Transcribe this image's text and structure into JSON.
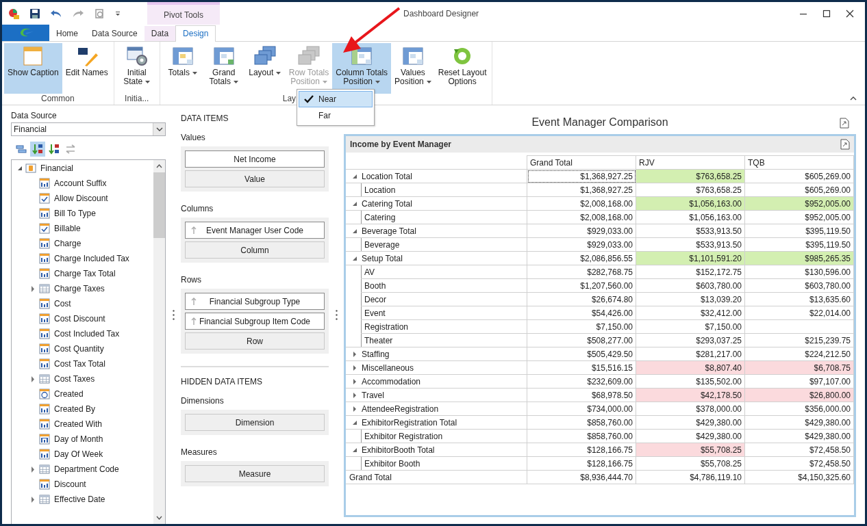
{
  "window": {
    "title": "Dashboard Designer"
  },
  "contextual_group": {
    "label": "Pivot Tools"
  },
  "tabs": [
    {
      "label": "Home",
      "selected": false,
      "contextual": false
    },
    {
      "label": "Data Source",
      "selected": false,
      "contextual": false
    },
    {
      "label": "Data",
      "selected": false,
      "contextual": true
    },
    {
      "label": "Design",
      "selected": true,
      "contextual": true
    }
  ],
  "ribbon_groups": [
    {
      "label": "Common",
      "buttons": [
        {
          "label": "Show Caption",
          "selected": true,
          "disabled": false,
          "dropdown": false
        },
        {
          "label": "Edit Names",
          "selected": false,
          "disabled": false,
          "dropdown": false
        }
      ]
    },
    {
      "label": "Initia...",
      "buttons": [
        {
          "label": "Initial\nState",
          "selected": false,
          "disabled": false,
          "dropdown": true
        }
      ]
    },
    {
      "label": "Lay",
      "buttons": [
        {
          "label": "Totals",
          "selected": false,
          "disabled": false,
          "dropdown": true
        },
        {
          "label": "Grand\nTotals",
          "selected": false,
          "disabled": false,
          "dropdown": true
        },
        {
          "label": "Layout",
          "selected": false,
          "disabled": false,
          "dropdown": true
        },
        {
          "label": "Row Totals\nPosition",
          "selected": false,
          "disabled": true,
          "dropdown": true
        },
        {
          "label": "Column Totals\nPosition",
          "selected": true,
          "disabled": false,
          "dropdown": true
        },
        {
          "label": "Values\nPosition",
          "selected": false,
          "disabled": false,
          "dropdown": true
        },
        {
          "label": "Reset Layout\nOptions",
          "selected": false,
          "disabled": false,
          "dropdown": false
        }
      ]
    }
  ],
  "dropdown_menu": [
    {
      "label": "Near",
      "checked": true,
      "selected": true
    },
    {
      "label": "Far",
      "checked": false,
      "selected": false
    }
  ],
  "data_source": {
    "label": "Data Source",
    "value": "Financial"
  },
  "field_toolbar": [
    {
      "selected": false
    },
    {
      "selected": true
    },
    {
      "selected": false
    },
    {
      "selected": false
    }
  ],
  "field_tree": {
    "label": "Financial",
    "expanded": true,
    "children": [
      {
        "label": "Account Suffix",
        "kind": "text"
      },
      {
        "label": "Allow Discount",
        "kind": "bool"
      },
      {
        "label": "Bill To Type",
        "kind": "text"
      },
      {
        "label": "Billable",
        "kind": "bool"
      },
      {
        "label": "Charge",
        "kind": "number"
      },
      {
        "label": "Charge Included Tax",
        "kind": "number"
      },
      {
        "label": "Charge Tax Total",
        "kind": "number"
      },
      {
        "label": "Charge Taxes",
        "kind": "table",
        "expanded": false
      },
      {
        "label": "Cost",
        "kind": "number"
      },
      {
        "label": "Cost Discount",
        "kind": "number"
      },
      {
        "label": "Cost Included Tax",
        "kind": "number"
      },
      {
        "label": "Cost Quantity",
        "kind": "number"
      },
      {
        "label": "Cost Tax Total",
        "kind": "number"
      },
      {
        "label": "Cost Taxes",
        "kind": "table",
        "expanded": false
      },
      {
        "label": "Created",
        "kind": "date"
      },
      {
        "label": "Created By",
        "kind": "text"
      },
      {
        "label": "Created With",
        "kind": "text"
      },
      {
        "label": "Day of Month",
        "kind": "integer"
      },
      {
        "label": "Day Of Week",
        "kind": "text"
      },
      {
        "label": "Department Code",
        "kind": "table",
        "expanded": false
      },
      {
        "label": "Discount",
        "kind": "number"
      },
      {
        "label": "Effective Date",
        "kind": "table",
        "expanded": false
      }
    ]
  },
  "data_items": {
    "heading": "DATA ITEMS",
    "sections": [
      {
        "title": "Values",
        "items": [
          {
            "label": "Net Income",
            "kind": "field",
            "sorted": false
          },
          {
            "label": "Value",
            "kind": "empty",
            "sorted": false
          }
        ]
      },
      {
        "title": "Columns",
        "items": [
          {
            "label": "Event Manager User Code",
            "kind": "field",
            "sorted": true
          },
          {
            "label": "Column",
            "kind": "empty",
            "sorted": false
          }
        ]
      },
      {
        "title": "Rows",
        "items": [
          {
            "label": "Financial Subgroup Type",
            "kind": "field",
            "sorted": true
          },
          {
            "label": "Financial Subgroup Item Code",
            "kind": "field",
            "sorted": true
          },
          {
            "label": "Row",
            "kind": "empty",
            "sorted": false
          }
        ]
      }
    ]
  },
  "hidden_data_items": {
    "heading": "HIDDEN DATA ITEMS",
    "sections": [
      {
        "title": "Dimensions",
        "items": [
          {
            "label": "Dimension",
            "kind": "empty",
            "sorted": false
          }
        ]
      },
      {
        "title": "Measures",
        "items": [
          {
            "label": "Measure",
            "kind": "empty",
            "sorted": false
          }
        ]
      }
    ]
  },
  "dashboard": {
    "title": "Event Manager Comparison"
  },
  "pivot": {
    "caption": "Income by Event Manager",
    "columns": [
      "Grand Total",
      "RJV",
      "TQB"
    ],
    "rows": [
      {
        "label": "Location Total",
        "kind": "group",
        "expanded": true,
        "cells": [
          {
            "text": "$1,368,927.25"
          },
          {
            "text": "$763,658.25",
            "color": "#d3efb1"
          },
          {
            "text": "$605,269.00"
          }
        ],
        "children": [
          {
            "label": "Location",
            "cells": [
              {
                "text": "$1,368,927.25"
              },
              {
                "text": "$763,658.25"
              },
              {
                "text": "$605,269.00"
              }
            ]
          }
        ]
      },
      {
        "label": "Catering Total",
        "kind": "group",
        "expanded": true,
        "cells": [
          {
            "text": "$2,008,168.00"
          },
          {
            "text": "$1,056,163.00",
            "color": "#d3efb1"
          },
          {
            "text": "$952,005.00",
            "color": "#d3efb1"
          }
        ],
        "children": [
          {
            "label": "Catering",
            "cells": [
              {
                "text": "$2,008,168.00"
              },
              {
                "text": "$1,056,163.00"
              },
              {
                "text": "$952,005.00"
              }
            ]
          }
        ]
      },
      {
        "label": "Beverage Total",
        "kind": "group",
        "expanded": true,
        "cells": [
          {
            "text": "$929,033.00"
          },
          {
            "text": "$533,913.50"
          },
          {
            "text": "$395,119.50"
          }
        ],
        "children": [
          {
            "label": "Beverage",
            "cells": [
              {
                "text": "$929,033.00"
              },
              {
                "text": "$533,913.50"
              },
              {
                "text": "$395,119.50"
              }
            ]
          }
        ]
      },
      {
        "label": "Setup Total",
        "kind": "group",
        "expanded": true,
        "cells": [
          {
            "text": "$2,086,856.55"
          },
          {
            "text": "$1,101,591.20",
            "color": "#d3efb1"
          },
          {
            "text": "$985,265.35",
            "color": "#d3efb1"
          }
        ],
        "children": [
          {
            "label": "AV",
            "cells": [
              {
                "text": "$282,768.75"
              },
              {
                "text": "$152,172.75"
              },
              {
                "text": "$130,596.00"
              }
            ]
          },
          {
            "label": "Booth",
            "cells": [
              {
                "text": "$1,207,560.00"
              },
              {
                "text": "$603,780.00"
              },
              {
                "text": "$603,780.00"
              }
            ]
          },
          {
            "label": "Decor",
            "cells": [
              {
                "text": "$26,674.80"
              },
              {
                "text": "$13,039.20"
              },
              {
                "text": "$13,635.60"
              }
            ]
          },
          {
            "label": "Event",
            "cells": [
              {
                "text": "$54,426.00"
              },
              {
                "text": "$32,412.00"
              },
              {
                "text": "$22,014.00"
              }
            ]
          },
          {
            "label": "Registration",
            "cells": [
              {
                "text": "$7,150.00"
              },
              {
                "text": "$7,150.00"
              },
              null
            ]
          },
          {
            "label": "Theater",
            "cells": [
              {
                "text": "$508,277.00"
              },
              {
                "text": "$293,037.25"
              },
              {
                "text": "$215,239.75"
              }
            ]
          }
        ]
      },
      {
        "label": "Staffing",
        "kind": "group",
        "expanded": false,
        "cells": [
          {
            "text": "$505,429.50"
          },
          {
            "text": "$281,217.00"
          },
          {
            "text": "$224,212.50"
          }
        ]
      },
      {
        "label": "Miscellaneous",
        "kind": "group",
        "expanded": false,
        "cells": [
          {
            "text": "$15,516.15"
          },
          {
            "text": "$8,807.40",
            "color": "#fbdadd"
          },
          {
            "text": "$6,708.75",
            "color": "#fbdadd"
          }
        ]
      },
      {
        "label": "Accommodation",
        "kind": "group",
        "expanded": false,
        "cells": [
          {
            "text": "$232,609.00"
          },
          {
            "text": "$135,502.00"
          },
          {
            "text": "$97,107.00"
          }
        ]
      },
      {
        "label": "Travel",
        "kind": "group",
        "expanded": false,
        "cells": [
          {
            "text": "$68,978.50"
          },
          {
            "text": "$42,178.50",
            "color": "#fbdadd"
          },
          {
            "text": "$26,800.00",
            "color": "#fbdadd"
          }
        ]
      },
      {
        "label": "AttendeeRegistration",
        "kind": "group",
        "expanded": false,
        "cells": [
          {
            "text": "$734,000.00"
          },
          {
            "text": "$378,000.00"
          },
          {
            "text": "$356,000.00"
          }
        ]
      },
      {
        "label": "ExhibitorRegistration Total",
        "kind": "group",
        "expanded": true,
        "cells": [
          {
            "text": "$858,760.00"
          },
          {
            "text": "$429,380.00"
          },
          {
            "text": "$429,380.00"
          }
        ],
        "children": [
          {
            "label": "Exhibitor Registration",
            "cells": [
              {
                "text": "$858,760.00"
              },
              {
                "text": "$429,380.00"
              },
              {
                "text": "$429,380.00"
              }
            ]
          }
        ]
      },
      {
        "label": "ExhibitorBooth Total",
        "kind": "group",
        "expanded": true,
        "cells": [
          {
            "text": "$128,166.75"
          },
          {
            "text": "$55,708.25",
            "color": "#fbdadd"
          },
          {
            "text": "$72,458.50"
          }
        ],
        "children": [
          {
            "label": "Exhibitor Booth",
            "cells": [
              {
                "text": "$128,166.75"
              },
              {
                "text": "$55,708.25"
              },
              {
                "text": "$72,458.50"
              }
            ]
          }
        ]
      },
      {
        "label": "Grand Total",
        "kind": "grand",
        "cells": [
          {
            "text": "$8,936,444.70"
          },
          {
            "text": "$4,786,119.10"
          },
          {
            "text": "$4,150,325.60"
          }
        ]
      }
    ]
  }
}
